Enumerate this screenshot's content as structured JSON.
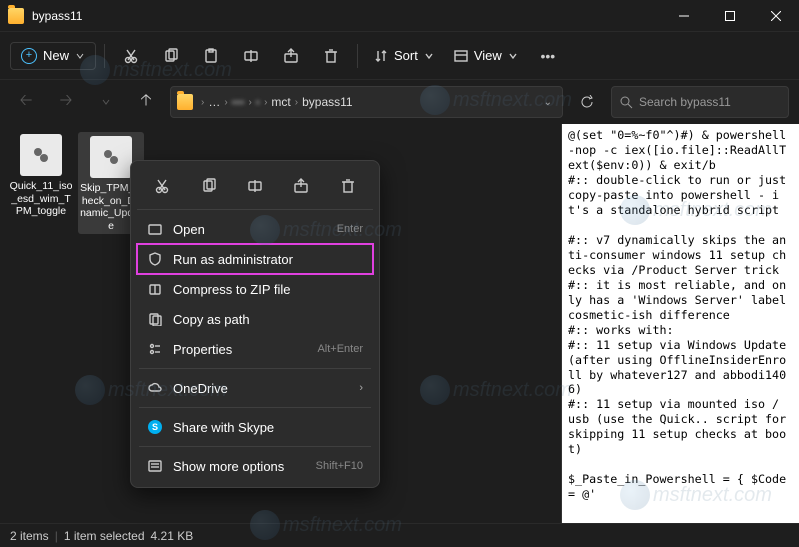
{
  "window": {
    "title": "bypass11"
  },
  "toolbar": {
    "new_label": "New",
    "sort_label": "Sort",
    "view_label": "View"
  },
  "address": {
    "crumbs": [
      "…",
      "▪▪▪",
      "▪",
      "mct",
      "bypass11"
    ]
  },
  "search": {
    "placeholder": "Search bypass11"
  },
  "files": [
    {
      "name": "Quick_11_iso_esd_wim_TPM_toggle"
    },
    {
      "name": "Skip_TPM_Check_on_Dynamic_Update"
    }
  ],
  "context_menu": {
    "open": "Open",
    "open_hint": "Enter",
    "run_admin": "Run as administrator",
    "compress": "Compress to ZIP file",
    "copy_path": "Copy as path",
    "properties": "Properties",
    "properties_hint": "Alt+Enter",
    "onedrive": "OneDrive",
    "skype": "Share with Skype",
    "more": "Show more options",
    "more_hint": "Shift+F10"
  },
  "preview_text": "@(set \"0=%~f0\"^)#) & powershell -nop -c iex([io.file]::ReadAllText($env:0)) & exit/b\n#:: double-click to run or just copy-paste into powershell - it's a standalone hybrid script\n\n#:: v7 dynamically skips the anti-consumer windows 11 setup checks via /Product Server trick\n#:: it is most reliable, and only has a 'Windows Server' label cosmetic-ish difference\n#:: works with:\n#:: 11 setup via Windows Update (after using OfflineInsiderEnroll by whatever127 and abbodi1406)\n#:: 11 setup via mounted iso / usb (use the Quick.. script for skipping 11 setup checks at boot)\n\n$_Paste_in_Powershell = { $Code = @'",
  "status": {
    "items": "2 items",
    "selected": "1 item selected",
    "size": "4.21 KB"
  },
  "watermark_text": "msftnext.com"
}
